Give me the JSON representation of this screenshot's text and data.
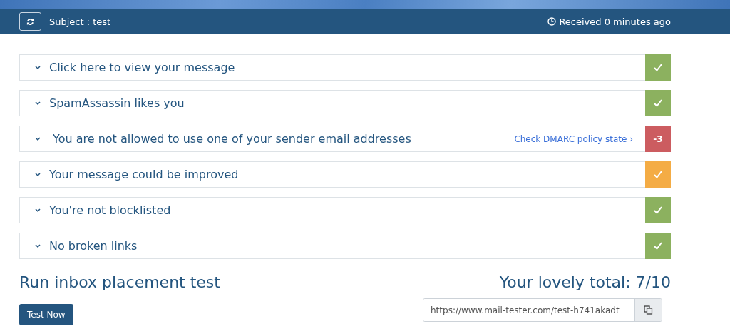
{
  "header": {
    "subject": "Subject : test",
    "received": "Received 0 minutes ago"
  },
  "results": [
    {
      "title": "Click here to view your message",
      "kind": "pass"
    },
    {
      "title": "SpamAssassin likes you",
      "kind": "pass"
    },
    {
      "title": "You are not allowed to use one of your sender email addresses",
      "kind": "fail",
      "score": "-3",
      "link": "Check DMARC policy state ›"
    },
    {
      "title": "Your message could be improved",
      "kind": "warn"
    },
    {
      "title": "You're not blocklisted",
      "kind": "pass"
    },
    {
      "title": "No broken links",
      "kind": "pass"
    }
  ],
  "inbox": {
    "heading": "Run inbox placement test",
    "button": "Test Now"
  },
  "total": {
    "label": "Your lovely total: 7/10",
    "url": "https://www.mail-tester.com/test-h741akadt"
  }
}
